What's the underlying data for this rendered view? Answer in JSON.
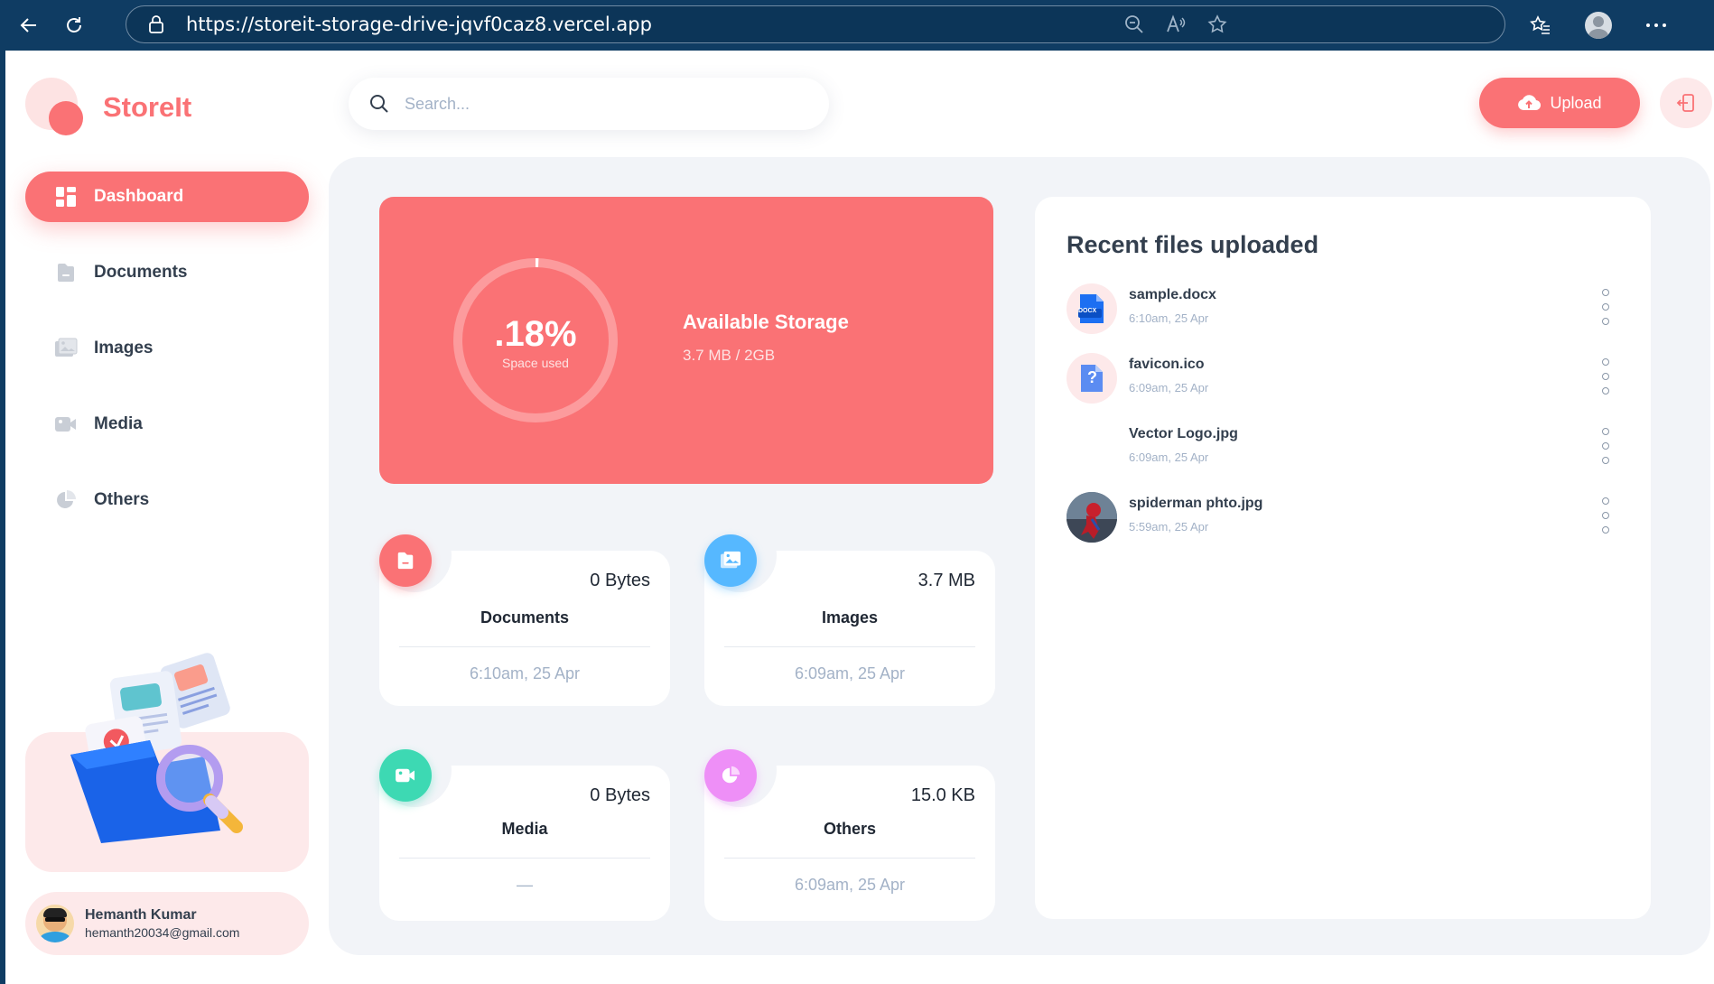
{
  "browser": {
    "url": "https://storeit-storage-drive-jqvf0caz8.vercel.app"
  },
  "app": {
    "logo_text": "StoreIt",
    "search_placeholder": "Search...",
    "upload_label": "Upload"
  },
  "sidebar": {
    "items": [
      {
        "label": "Dashboard",
        "icon": "dashboard-icon",
        "active": true
      },
      {
        "label": "Documents",
        "icon": "documents-icon",
        "active": false
      },
      {
        "label": "Images",
        "icon": "images-icon",
        "active": false
      },
      {
        "label": "Media",
        "icon": "media-icon",
        "active": false
      },
      {
        "label": "Others",
        "icon": "others-icon",
        "active": false
      }
    ],
    "user": {
      "name": "Hemanth Kumar",
      "email": "hemanth20034@gmail.com"
    }
  },
  "storage": {
    "percent": ".18%",
    "percent_label": "Space used",
    "title": "Available Storage",
    "used": "3.7 MB",
    "separator": "/",
    "total": "2GB",
    "used_fraction": 0.0018
  },
  "summary": [
    {
      "title": "Documents",
      "size": "0 Bytes",
      "date": "6:10am, 25 Apr",
      "color": "#fa7275",
      "icon": "document-icon"
    },
    {
      "title": "Images",
      "size": "3.7 MB",
      "date": "6:09am, 25 Apr",
      "color": "#56b8ff",
      "icon": "image-icon"
    },
    {
      "title": "Media",
      "size": "0 Bytes",
      "date": "—",
      "color": "#3dd9b3",
      "icon": "video-icon"
    },
    {
      "title": "Others",
      "size": "15.0 KB",
      "date": "6:09am, 25 Apr",
      "color": "#ee8ff7",
      "icon": "pie-icon"
    }
  ],
  "recent": {
    "heading": "Recent files uploaded",
    "files": [
      {
        "name": "sample.docx",
        "date": "6:10am, 25 Apr",
        "thumb": "docx-icon",
        "thumb_text": "DOCX"
      },
      {
        "name": "favicon.ico",
        "date": "6:09am, 25 Apr",
        "thumb": "unknown-file-icon",
        "thumb_text": "?"
      },
      {
        "name": "Vector Logo.jpg",
        "date": "6:09am, 25 Apr",
        "thumb": "blank-thumbnail"
      },
      {
        "name": "spiderman phto.jpg",
        "date": "5:59am, 25 Apr",
        "thumb": "photo-thumbnail"
      }
    ]
  },
  "colors": {
    "brand": "#fa7275",
    "panel": "#f2f4f8",
    "text": "#333f4e",
    "muted": "#a3b2c7"
  }
}
